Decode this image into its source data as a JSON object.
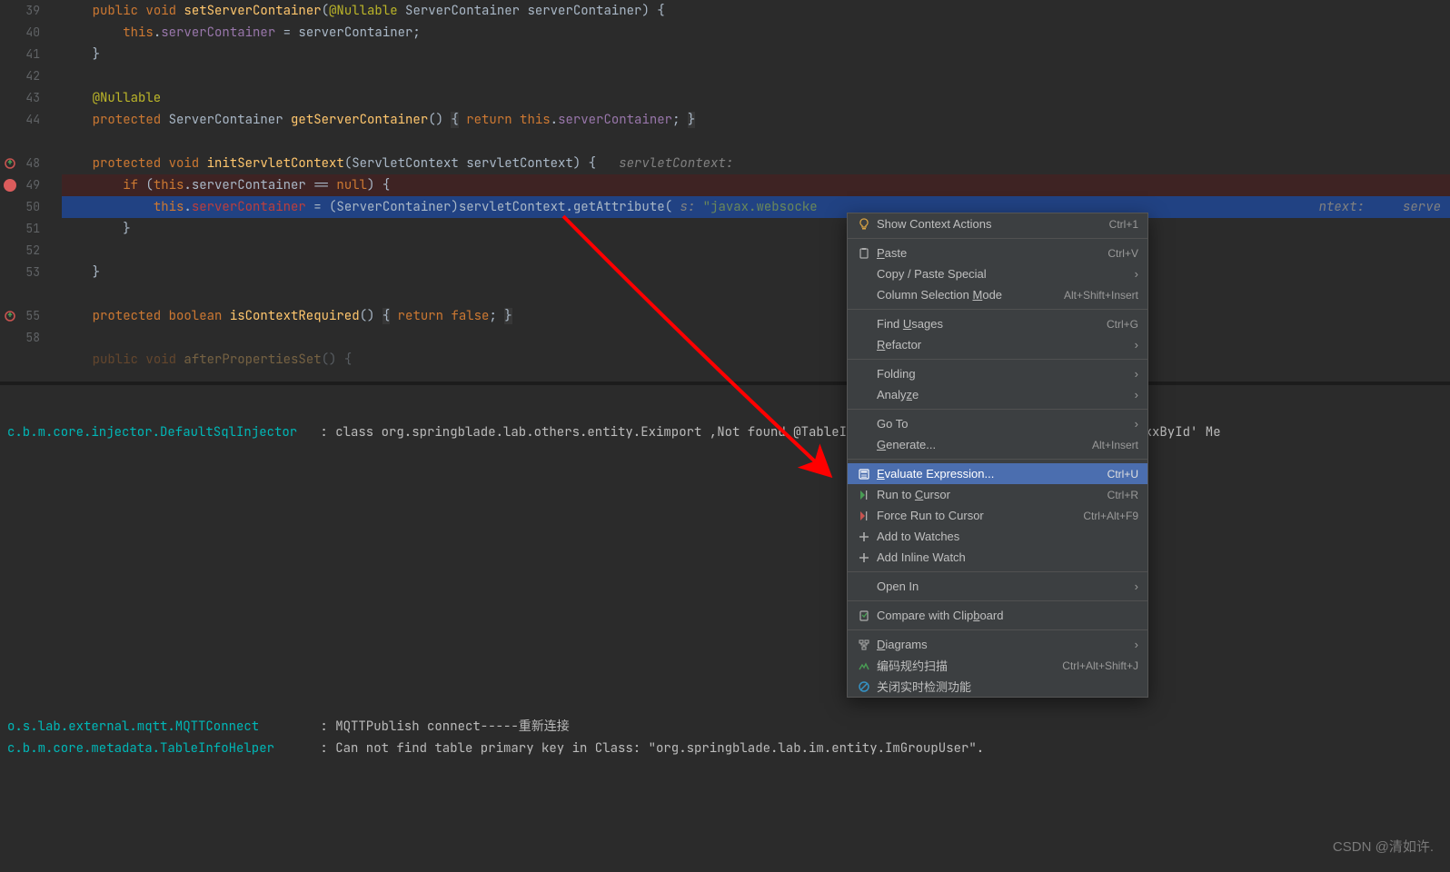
{
  "lines": [
    {
      "n": 39
    },
    {
      "n": 40
    },
    {
      "n": 41
    },
    {
      "n": 42
    },
    {
      "n": 43
    },
    {
      "n": 44
    },
    {
      "n": ""
    },
    {
      "n": 48,
      "mark": "override"
    },
    {
      "n": 49,
      "mark": "bp"
    },
    {
      "n": 50
    },
    {
      "n": 51
    },
    {
      "n": 52
    },
    {
      "n": 53
    },
    {
      "n": ""
    },
    {
      "n": 55,
      "mark": "override"
    },
    {
      "n": 58
    },
    {
      "n": ""
    }
  ],
  "code": {
    "l39": [
      "public ",
      "void ",
      "setServerContainer",
      "(",
      "@Nullable",
      " ServerContainer serverContainer) {"
    ],
    "l40": [
      "this",
      ".",
      "serverContainer",
      " = serverContainer;"
    ],
    "l41": "}",
    "l43": "@Nullable",
    "l44": [
      "protected ",
      "ServerContainer ",
      "getServerContainer",
      "() ",
      "{",
      " ",
      "return ",
      "this",
      ".",
      "serverContainer",
      "; ",
      "}"
    ],
    "l48": [
      "protected ",
      "void ",
      "initServletContext",
      "(ServletContext servletContext) {   ",
      "servletContext:"
    ],
    "l49": [
      "if ",
      "(",
      "this",
      ".serverContainer == ",
      "null",
      ") {"
    ],
    "l50": [
      "this",
      ".",
      "serverContainer",
      " = (ServerContainer)servletContext.getAttribute(",
      "s:",
      "\"javax.websocke",
      "ntext:     serve"
    ],
    "l51": "}",
    "l53": "}",
    "l55": [
      "protected ",
      "boolean ",
      "isContextRequired",
      "() ",
      "{",
      " ",
      "return ",
      "false",
      "; ",
      "}"
    ],
    "l58_partial": [
      "public ",
      "void ",
      "afterPropertiesSet",
      "() {"
    ]
  },
  "console": {
    "l1a": "c.b.m.core.injector.DefaultSqlInjector",
    "l1b": ": class org.springblade.lab.others.entity.Eximport ,Not found @TableId annotation, Cannot use Mybatis-Plus 'xxById' Me",
    "l2a": "o.s.lab.external.mqtt.MQTTConnect",
    "l2b": ": MQTTPublish connect-----重新连接",
    "l3a": "c.b.m.core.metadata.TableInfoHelper",
    "l3b": ": Can not find table primary key in Class: \"org.springblade.lab.im.entity.ImGroupUser\"."
  },
  "watermark": "CSDN @清如许.",
  "menu": [
    {
      "type": "item",
      "icon": "bulb",
      "label": "Show Context Actions",
      "hint": "Ctrl+1"
    },
    {
      "type": "sep"
    },
    {
      "type": "item",
      "icon": "paste",
      "label_html": "<span class='und'>P</span>aste",
      "hint": "Ctrl+V"
    },
    {
      "type": "item",
      "label": "Copy / Paste Special",
      "sub": "›"
    },
    {
      "type": "item",
      "label_html": "Column Selection <span class='und'>M</span>ode",
      "hint": "Alt+Shift+Insert"
    },
    {
      "type": "sep"
    },
    {
      "type": "item",
      "label_html": "Find <span class='und'>U</span>sages",
      "hint": "Ctrl+G"
    },
    {
      "type": "item",
      "label_html": "<span class='und'>R</span>efactor",
      "sub": "›"
    },
    {
      "type": "sep"
    },
    {
      "type": "item",
      "label": "Folding",
      "sub": "›"
    },
    {
      "type": "item",
      "label_html": "Analy<span class='und'>z</span>e",
      "sub": "›"
    },
    {
      "type": "sep"
    },
    {
      "type": "item",
      "label": "Go To",
      "sub": "›"
    },
    {
      "type": "item",
      "label_html": "<span class='und'>G</span>enerate...",
      "hint": "Alt+Insert"
    },
    {
      "type": "sep"
    },
    {
      "type": "item",
      "icon": "calc",
      "label_html": "<span class='und'>E</span>valuate Expression...",
      "hint": "Ctrl+U",
      "sel": true
    },
    {
      "type": "item",
      "icon": "runto",
      "label_html": "Run to <span class='und'>C</span>ursor",
      "hint": "Ctrl+R"
    },
    {
      "type": "item",
      "icon": "forcerunto",
      "label": "Force Run to Cursor",
      "hint": "Ctrl+Alt+F9"
    },
    {
      "type": "item",
      "icon": "plus",
      "label": "Add to Watches"
    },
    {
      "type": "item",
      "icon": "plus",
      "label": "Add Inline Watch"
    },
    {
      "type": "sep"
    },
    {
      "type": "item",
      "label": "Open In",
      "sub": "›"
    },
    {
      "type": "sep"
    },
    {
      "type": "item",
      "icon": "clip",
      "label_html": "Compare with Clip<span class='und'>b</span>oard"
    },
    {
      "type": "sep"
    },
    {
      "type": "item",
      "icon": "diag",
      "label_html": "<span class='und'>D</span>iagrams",
      "sub": "›"
    },
    {
      "type": "item",
      "icon": "scan",
      "label": "编码规约扫描",
      "hint": "Ctrl+Alt+Shift+J"
    },
    {
      "type": "item",
      "icon": "stop",
      "label": "关闭实时检测功能"
    }
  ]
}
